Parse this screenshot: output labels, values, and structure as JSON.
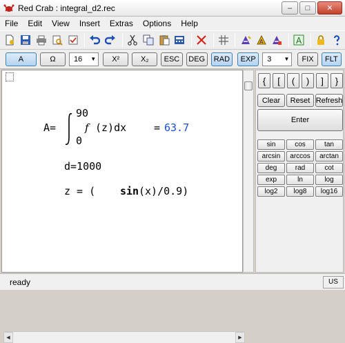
{
  "window": {
    "title": "Red Crab : integral_d2.rec",
    "minimize": "–",
    "maximize": "□",
    "close": "✕"
  },
  "menu": {
    "items": [
      "File",
      "Edit",
      "View",
      "Insert",
      "Extras",
      "Options",
      "Help"
    ]
  },
  "toolbar": {
    "icons": [
      "new-file-icon",
      "save-icon",
      "print-icon",
      "print-preview-icon",
      "properties-icon",
      "undo-icon",
      "redo-icon",
      "cut-icon",
      "copy-icon",
      "paste-icon",
      "calculator-icon",
      "delete-icon",
      "grid-icon",
      "font-a-icon",
      "font-a-size-icon",
      "font-a-color-icon",
      "text-a-icon",
      "lock-icon",
      "help-icon"
    ]
  },
  "keypad_bar": {
    "a_label": "A",
    "omega_label": "Ω",
    "font_size": "16",
    "sup_label": "X²",
    "sub_label": "X₂",
    "esc_label": "ESC",
    "deg_label": "DEG",
    "rad_label": "RAD",
    "exp_label": "EXP",
    "precision": "3",
    "fix_label": "FIX",
    "flt_label": "FLT"
  },
  "document": {
    "line1": {
      "lhs": "A=",
      "upper": "90",
      "lower": "0",
      "f": "f",
      "body": "(z)dx",
      "eq": "=",
      "result": "63.7"
    },
    "line2": "d=1000",
    "line3": {
      "lhs": "z = (",
      "fn": "sin",
      "rest": "(x)/0.9)"
    }
  },
  "panel": {
    "brackets": [
      "{",
      "[",
      "(",
      ")",
      "]",
      "}"
    ],
    "clear": "Clear",
    "reset": "Reset",
    "refresh": "Refresh",
    "enter": "Enter",
    "functions": [
      [
        "sin",
        "cos",
        "tan"
      ],
      [
        "arcsin",
        "arccos",
        "arctan"
      ],
      [
        "deg",
        "rad",
        "cot"
      ],
      [
        "exp",
        "ln",
        "log"
      ],
      [
        "log2",
        "log8",
        "log16"
      ]
    ]
  },
  "status": {
    "text": "ready",
    "locale": "US"
  },
  "colors": {
    "result_blue": "#1a4fd1"
  }
}
